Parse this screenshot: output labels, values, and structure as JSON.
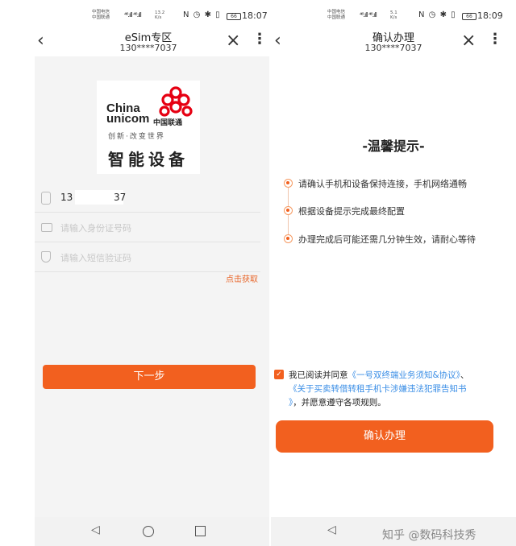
{
  "left_screen": {
    "status_bar": {
      "carrier_1": "中国电信",
      "carrier_2": "中国联通",
      "signal": "⁴⁶.ıll ⁴⁶.ıll",
      "speed_value": "13.2",
      "speed_unit": "K/s",
      "icons": "N ◷ ✱ ▯",
      "battery": "66",
      "time": "18:07"
    },
    "title_bar": {
      "back_icon": "back-chevron-icon",
      "title": "eSim专区",
      "subtitle": "130****7037",
      "close_icon": "close-icon",
      "more_icon": "more-vertical-icon"
    },
    "logo": {
      "brand_en_1": "China",
      "brand_en_2": "unicom",
      "brand_cn": "中国联通",
      "slogan": "创新·改变世界",
      "label": "智能设备"
    },
    "form": {
      "phone_prefix": "13",
      "phone_suffix": "37",
      "id_placeholder": "请输入身份证号码",
      "sms_placeholder": "请输入短信验证码",
      "get_code_link": "点击获取"
    },
    "next_button": "下一步"
  },
  "right_screen": {
    "status_bar": {
      "carrier_1": "中国电信",
      "carrier_2": "中国联通",
      "signal": "⁴⁶.ıll ⁴⁶.ıll",
      "speed_value": "5.1",
      "speed_unit": "K/s",
      "icons": "N ◷ ✱ ▯",
      "battery": "66",
      "time": "18:09"
    },
    "title_bar": {
      "back_icon": "back-chevron-icon",
      "title": "确认办理",
      "subtitle": "130****7037",
      "close_icon": "close-icon",
      "more_icon": "more-vertical-icon"
    },
    "notice": {
      "title": "-温馨提示-",
      "items": [
        "请确认手机和设备保持连接，手机网络通畅",
        "根据设备提示完成最终配置",
        "办理完成后可能还需几分钟生效，请耐心等待"
      ]
    },
    "agreement": {
      "checked": true,
      "prefix": "我已阅读并同意",
      "link_1": "《一号双终端业务须知&协议》",
      "separator": "、",
      "link_2": "《关于买卖转借转租手机卡涉嫌违法犯罪告知书",
      "link_2_end": "》",
      "suffix": "，并愿意遵守各项规则。"
    },
    "confirm_button": "确认办理"
  },
  "watermark": "知乎 @数码科技秀",
  "accent_color": "#f2601f",
  "link_color": "#3a8ee6"
}
